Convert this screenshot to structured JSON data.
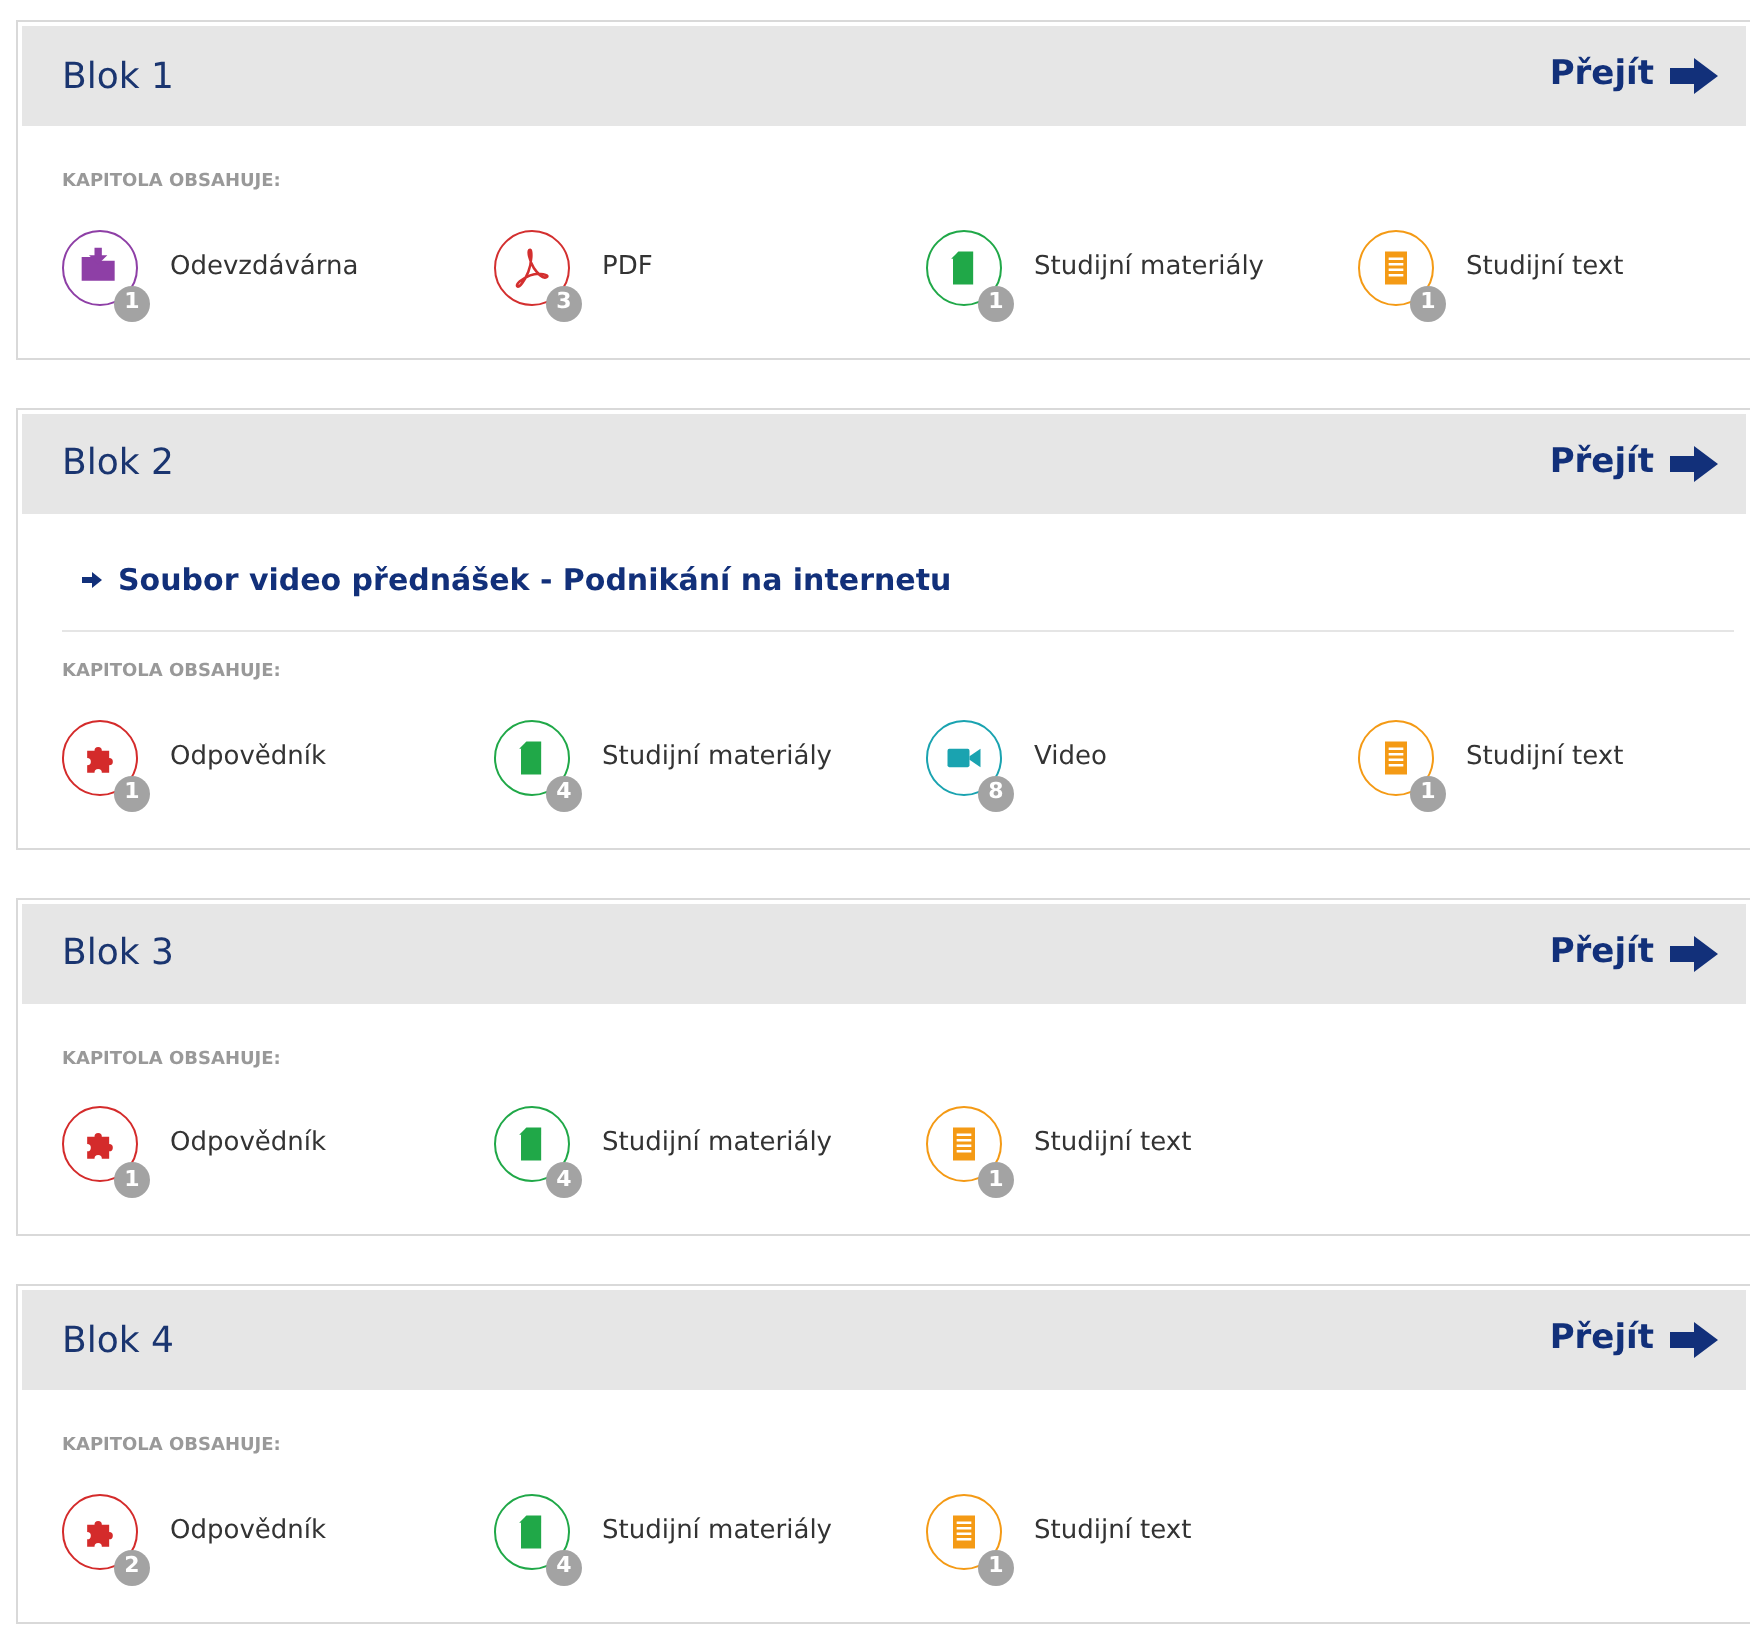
{
  "blocks": [
    {
      "title": "Blok 1",
      "go_label": "Přejít",
      "contents_label": "KAPITOLA OBSAHUJE:",
      "items": [
        {
          "kind": "folder",
          "label": "Odevzdávárna",
          "count": "1"
        },
        {
          "kind": "pdf",
          "label": "PDF",
          "count": "3"
        },
        {
          "kind": "doc",
          "label": "Studijní materiály",
          "count": "1"
        },
        {
          "kind": "text",
          "label": "Studijní text",
          "count": "1"
        }
      ]
    },
    {
      "title": "Blok 2",
      "go_label": "Přejít",
      "links": [
        "Soubor video přednášek - Podnikání na internetu"
      ],
      "contents_label": "KAPITOLA OBSAHUJE:",
      "items": [
        {
          "kind": "puzzle",
          "label": "Odpovědník",
          "count": "1"
        },
        {
          "kind": "doc",
          "label": "Studijní materiály",
          "count": "4"
        },
        {
          "kind": "video",
          "label": "Video",
          "count": "8"
        },
        {
          "kind": "text",
          "label": "Studijní text",
          "count": "1"
        }
      ]
    },
    {
      "title": "Blok 3",
      "go_label": "Přejít",
      "contents_label": "KAPITOLA OBSAHUJE:",
      "items": [
        {
          "kind": "puzzle",
          "label": "Odpovědník",
          "count": "1"
        },
        {
          "kind": "doc",
          "label": "Studijní materiály",
          "count": "4"
        },
        {
          "kind": "text",
          "label": "Studijní text",
          "count": "1"
        }
      ]
    },
    {
      "title": "Blok 4",
      "go_label": "Přejít",
      "contents_label": "KAPITOLA OBSAHUJE:",
      "items": [
        {
          "kind": "puzzle",
          "label": "Odpovědník",
          "count": "2"
        },
        {
          "kind": "doc",
          "label": "Studijní materiály",
          "count": "4"
        },
        {
          "kind": "text",
          "label": "Studijní text",
          "count": "1"
        }
      ]
    }
  ]
}
